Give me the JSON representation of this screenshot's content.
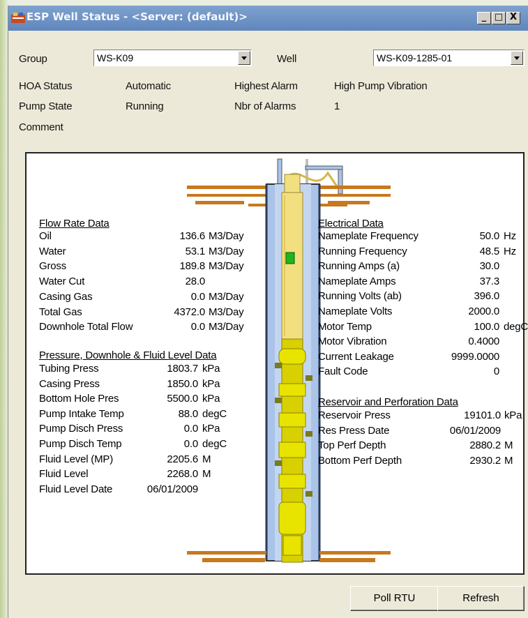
{
  "window": {
    "title": "ESP Well Status  -  <Server: (default)>"
  },
  "title_buttons": {
    "minimize": "_",
    "maximize": "□",
    "close": "X"
  },
  "header": {
    "group_label": "Group",
    "group_value": "WS-K09",
    "well_label": "Well",
    "well_value": "WS-K09-1285-01",
    "hoa_label": "HOA Status",
    "hoa_value": "Automatic",
    "highest_alarm_label": "Highest Alarm",
    "highest_alarm_value": "High Pump Vibration",
    "pump_state_label": "Pump State",
    "pump_state_value": "Running",
    "nbr_alarms_label": "Nbr of Alarms",
    "nbr_alarms_value": "1",
    "comment_label": "Comment"
  },
  "flow": {
    "title": "Flow Rate Data",
    "rows": [
      {
        "name": "Oil",
        "value": "136.6",
        "unit": "M3/Day"
      },
      {
        "name": "Water",
        "value": "53.1",
        "unit": "M3/Day"
      },
      {
        "name": "Gross",
        "value": "189.8",
        "unit": "M3/Day"
      },
      {
        "name": "Water Cut",
        "value": "28.0",
        "unit": ""
      },
      {
        "name": "Casing Gas",
        "value": "0.0",
        "unit": "M3/Day"
      },
      {
        "name": "Total Gas",
        "value": "4372.0",
        "unit": "M3/Day"
      },
      {
        "name": "Downhole Total Flow",
        "value": "0.0",
        "unit": "M3/Day"
      }
    ]
  },
  "pressure": {
    "title": "Pressure, Downhole & Fluid Level Data",
    "rows": [
      {
        "name": "Tubing Press",
        "value": "1803.7",
        "unit": "kPa"
      },
      {
        "name": "Casing Press",
        "value": "1850.0",
        "unit": "kPa"
      },
      {
        "name": "Bottom Hole Pres",
        "value": "5500.0",
        "unit": "kPa"
      },
      {
        "name": "Pump Intake Temp",
        "value": "88.0",
        "unit": "degC"
      },
      {
        "name": "Pump Disch Press",
        "value": "0.0",
        "unit": "kPa"
      },
      {
        "name": "Pump Disch Temp",
        "value": "0.0",
        "unit": "degC"
      },
      {
        "name": "Fluid Level (MP)",
        "value": "2205.6",
        "unit": "M"
      },
      {
        "name": "Fluid Level",
        "value": "2268.0",
        "unit": "M"
      },
      {
        "name": "Fluid Level Date",
        "value": "06/01/2009",
        "unit": ""
      }
    ]
  },
  "electrical": {
    "title": "Electrical Data",
    "rows": [
      {
        "name": "Nameplate Frequency",
        "value": "50.0",
        "unit": "Hz"
      },
      {
        "name": "Running Frequency",
        "value": "48.5",
        "unit": "Hz"
      },
      {
        "name": "Running Amps (a)",
        "value": "30.0",
        "unit": ""
      },
      {
        "name": "Nameplate Amps",
        "value": "37.3",
        "unit": ""
      },
      {
        "name": "Running Volts (ab)",
        "value": "396.0",
        "unit": ""
      },
      {
        "name": "Nameplate Volts",
        "value": "2000.0",
        "unit": ""
      },
      {
        "name": "Motor Temp",
        "value": "100.0",
        "unit": "degC"
      },
      {
        "name": "Motor Vibration",
        "value": "0.4000",
        "unit": ""
      },
      {
        "name": "Current Leakage",
        "value": "9999.0000",
        "unit": ""
      },
      {
        "name": "Fault Code",
        "value": "0",
        "unit": ""
      }
    ]
  },
  "reservoir": {
    "title": "Reservoir and Perforation Data",
    "rows": [
      {
        "name": "Reservoir Press",
        "value": "19101.0",
        "unit": "kPa"
      },
      {
        "name": "Res Press Date",
        "value": "06/01/2009",
        "unit": ""
      },
      {
        "name": "Top Perf Depth",
        "value": "2880.2",
        "unit": "M"
      },
      {
        "name": "Bottom Perf Depth",
        "value": "2930.2",
        "unit": "M"
      }
    ]
  },
  "buttons": {
    "poll_rtu": "Poll RTU",
    "refresh": "Refresh"
  },
  "colors": {
    "titlebar": "#6b90c4",
    "ground": "#c8781e",
    "pump": "#f2e080",
    "motor": "#d8d000",
    "casing": "#a9c4e8",
    "indicator": "#1fb51f"
  }
}
